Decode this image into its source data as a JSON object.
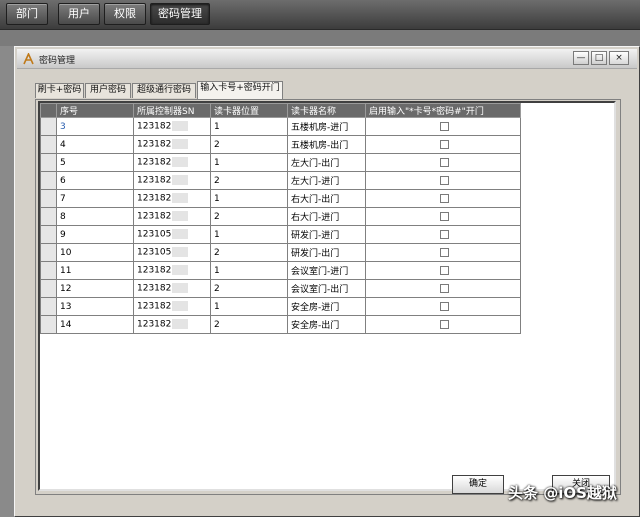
{
  "topnav": {
    "items": [
      {
        "label": "部门"
      },
      {
        "label": "用户"
      },
      {
        "label": "权限"
      },
      {
        "label": "密码管理"
      }
    ]
  },
  "window": {
    "title": "密码管理",
    "min_glyph": "—",
    "max_glyph": "□",
    "close_glyph": "×"
  },
  "tabs": [
    {
      "label": "刷卡+密码"
    },
    {
      "label": "用户密码"
    },
    {
      "label": "超级通行密码"
    },
    {
      "label": "输入卡号+密码开门"
    }
  ],
  "grid": {
    "columns": [
      "序号",
      "所属控制器SN",
      "读卡器位置",
      "读卡器名称",
      "启用输入\"*卡号*密码#\"开门"
    ],
    "rows": [
      {
        "no": "3",
        "sn": "123182",
        "pos": "1",
        "name": "五楼机房-进门",
        "checked": false
      },
      {
        "no": "4",
        "sn": "123182",
        "pos": "2",
        "name": "五楼机房-出门",
        "checked": false
      },
      {
        "no": "5",
        "sn": "123182",
        "pos": "1",
        "name": "左大门-出门",
        "checked": false
      },
      {
        "no": "6",
        "sn": "123182",
        "pos": "2",
        "name": "左大门-进门",
        "checked": false
      },
      {
        "no": "7",
        "sn": "123182",
        "pos": "1",
        "name": "右大门-出门",
        "checked": false
      },
      {
        "no": "8",
        "sn": "123182",
        "pos": "2",
        "name": "右大门-进门",
        "checked": false
      },
      {
        "no": "9",
        "sn": "123105",
        "pos": "1",
        "name": "研发门-进门",
        "checked": false
      },
      {
        "no": "10",
        "sn": "123105",
        "pos": "2",
        "name": "研发门-出门",
        "checked": false
      },
      {
        "no": "11",
        "sn": "123182",
        "pos": "1",
        "name": "会议室门-进门",
        "checked": false
      },
      {
        "no": "12",
        "sn": "123182",
        "pos": "2",
        "name": "会议室门-出门",
        "checked": false
      },
      {
        "no": "13",
        "sn": "123182",
        "pos": "1",
        "name": "安全房-进门",
        "checked": false
      },
      {
        "no": "14",
        "sn": "123182",
        "pos": "2",
        "name": "安全房-出门",
        "checked": false
      }
    ]
  },
  "buttons": {
    "ok": "确定",
    "close": "关闭"
  },
  "watermark": "头条 @iOS越狱"
}
